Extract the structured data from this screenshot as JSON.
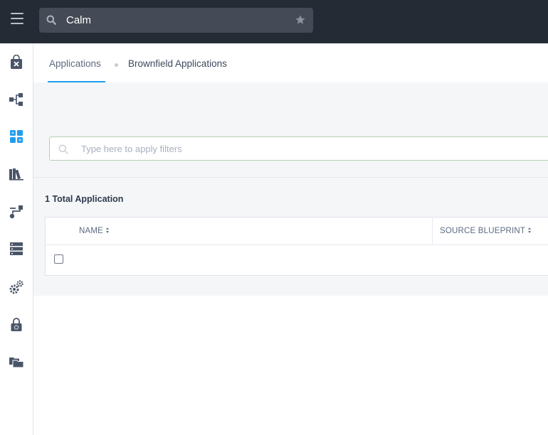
{
  "header": {
    "search_value": "Calm"
  },
  "sidebar": {
    "items": [
      {
        "icon": "blueprint-bag-icon"
      },
      {
        "icon": "topology-icon"
      },
      {
        "icon": "applications-grid-icon",
        "active": true
      },
      {
        "icon": "library-books-icon"
      },
      {
        "icon": "runbook-path-icon"
      },
      {
        "icon": "endpoints-stack-icon"
      },
      {
        "icon": "settings-gears-icon"
      },
      {
        "icon": "policy-lock-icon"
      },
      {
        "icon": "projects-folders-icon"
      }
    ]
  },
  "tabs": [
    {
      "label": "Applications",
      "active": true
    },
    {
      "label": "Brownfield Applications",
      "active": false
    }
  ],
  "filter": {
    "placeholder": "Type here to apply filters"
  },
  "summary": {
    "count": "1",
    "label": "Total Application"
  },
  "table": {
    "columns": [
      "NAME",
      "SOURCE BLUEPRINT"
    ]
  },
  "colors": {
    "topbar": "#252b35",
    "accent": "#1f9ded",
    "icon": "#4a5568"
  }
}
